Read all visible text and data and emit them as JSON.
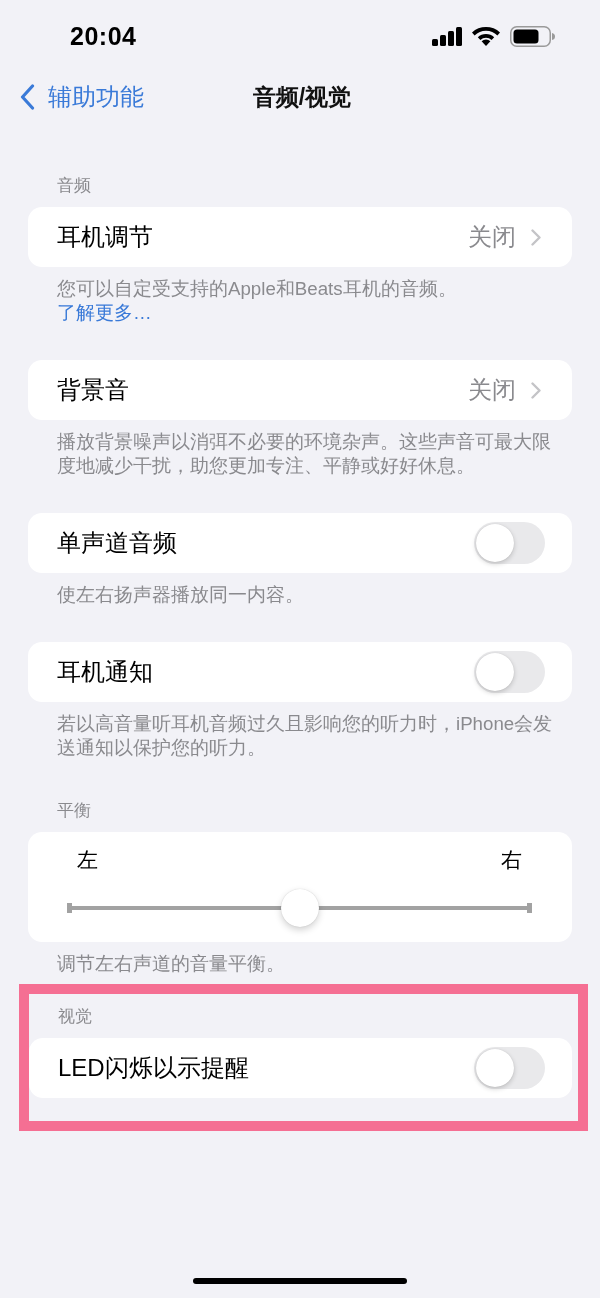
{
  "status_bar": {
    "time": "20:04"
  },
  "nav": {
    "back_label": "辅助功能",
    "title": "音频/视觉"
  },
  "groups": [
    {
      "header": "音频",
      "highlighted": false,
      "row": {
        "kind": "link",
        "label": "耳机调节",
        "value": "关闭"
      },
      "footer": "您可以自定受支持的Apple和Beats耳机的音频。",
      "footer_link": "了解更多…"
    },
    {
      "highlighted": false,
      "row": {
        "kind": "link",
        "label": "背景音",
        "value": "关闭"
      },
      "footer": "播放背景噪声以消弭不必要的环境杂声。这些声音可最大限度地减少干扰，助您更加专注、平静或好好休息。"
    },
    {
      "highlighted": false,
      "row": {
        "kind": "toggle",
        "label": "单声道音频",
        "on": false
      },
      "footer": "使左右扬声器播放同一内容。"
    },
    {
      "highlighted": false,
      "row": {
        "kind": "toggle",
        "label": "耳机通知",
        "on": false
      },
      "footer": "若以高音量听耳机音频过久且影响您的听力时，iPhone会发送通知以保护您的听力。"
    },
    {
      "header": "平衡",
      "highlighted": false,
      "row": {
        "kind": "slider",
        "left_label": "左",
        "right_label": "右",
        "level": 0.5
      },
      "footer": "调节左右声道的音量平衡。"
    },
    {
      "header": "视觉",
      "highlighted": true,
      "row": {
        "kind": "toggle",
        "label": "LED闪烁以示提醒",
        "on": false
      }
    }
  ]
}
